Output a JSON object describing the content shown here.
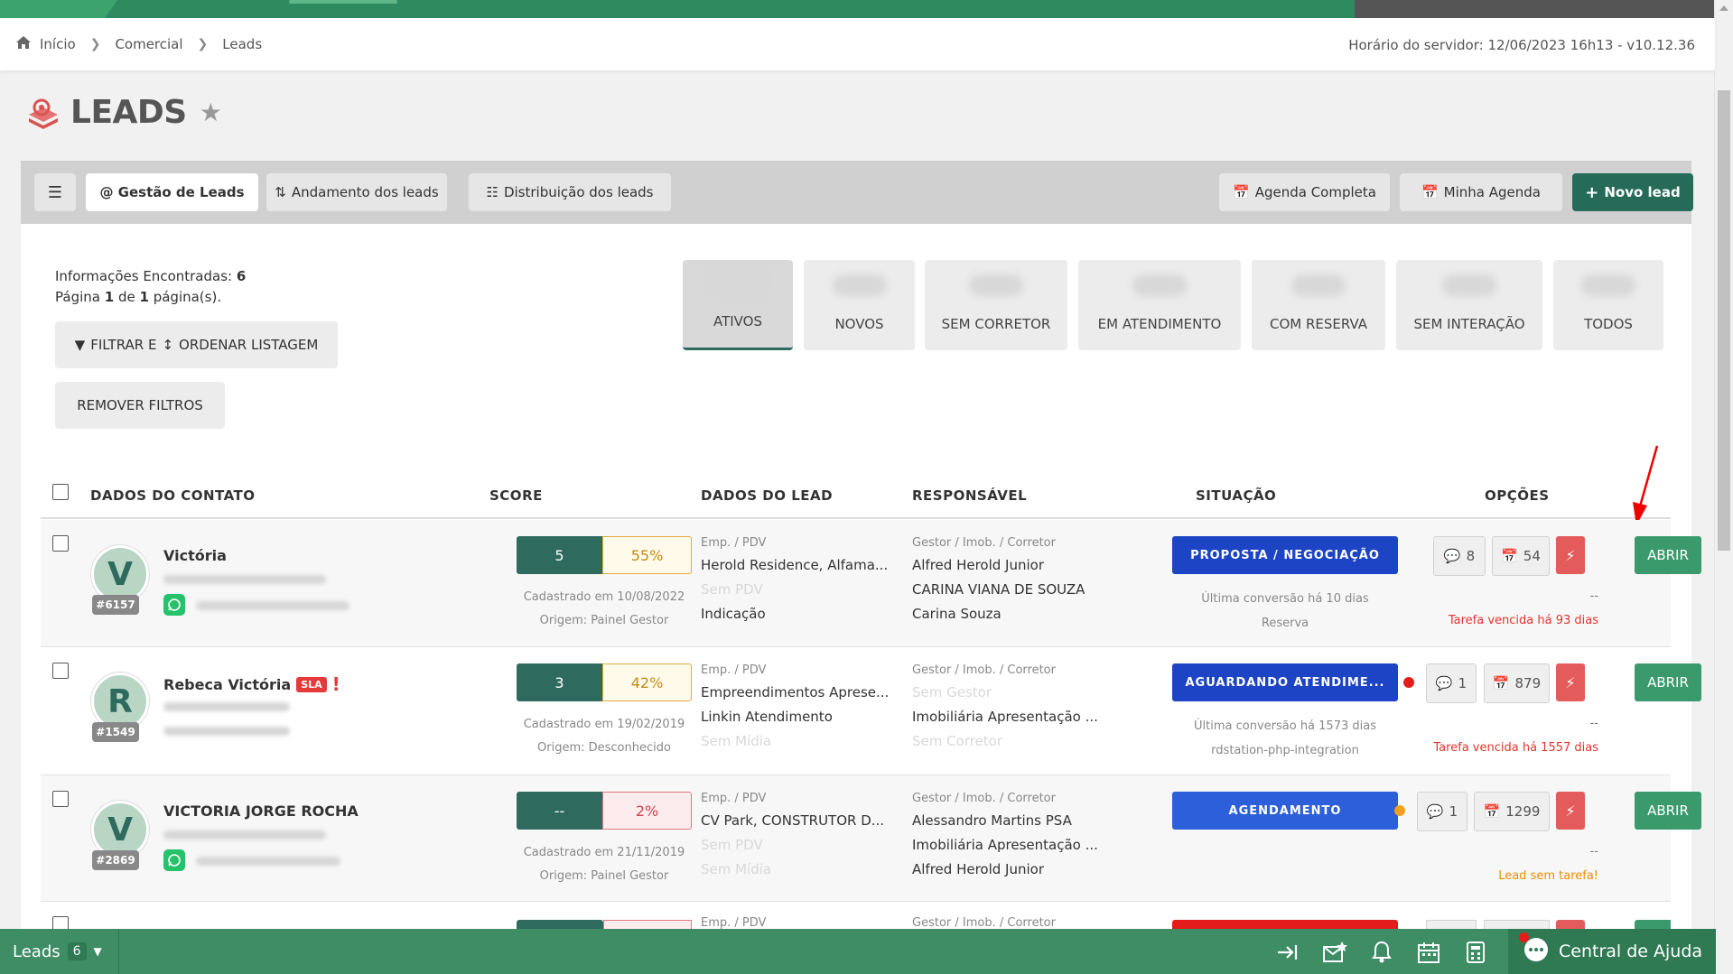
{
  "breadcrumb": {
    "home": "Início",
    "level1": "Comercial",
    "level2": "Leads"
  },
  "server_time": "Horário do servidor: 12/06/2023 16h13 - v10.12.36",
  "page_title": "LEADS",
  "toolbar": {
    "gestao": "@ Gestão de Leads",
    "andamento": "Andamento dos leads",
    "distribuicao": "Distribuição dos leads",
    "agenda_completa": "Agenda Completa",
    "minha_agenda": "Minha Agenda",
    "novo_lead": "Novo lead"
  },
  "info": {
    "found_label": "Informações Encontradas:",
    "found_count": "6",
    "page_a": "Página",
    "page_num": "1",
    "page_b": "de",
    "page_total": "1",
    "page_c": "página(s)."
  },
  "filters": {
    "filter_btn": "FILTRAR E",
    "order_btn": "ORDENAR LISTAGEM",
    "remove_btn": "REMOVER FILTROS"
  },
  "tabs": [
    "ATIVOS",
    "NOVOS",
    "SEM CORRETOR",
    "EM ATENDIMENTO",
    "COM RESERVA",
    "SEM INTERAÇÃO",
    "TODOS"
  ],
  "table": {
    "headers": {
      "contato": "DADOS DO CONTATO",
      "score": "SCORE",
      "lead": "DADOS DO LEAD",
      "responsavel": "RESPONSÁVEL",
      "situacao": "SITUAÇÃO",
      "opcoes": "OPÇÕES"
    },
    "rows": [
      {
        "initial": "V",
        "id": "#6157",
        "name": "Victória",
        "score": "5",
        "pct": "55%",
        "cadastrado": "Cadastrado em 10/08/2022",
        "origem": "Origem: Painel Gestor",
        "emp_label": "Emp. / PDV",
        "emp": "Herold Residence, Alfama...",
        "pdv": "Sem PDV",
        "midia": "Indicação",
        "resp_label": "Gestor / Imob. / Corretor",
        "gestor": "Alfred Herold Junior",
        "imob": "CARINA VIANA DE SOUZA",
        "corretor": "Carina Souza",
        "situacao": "PROPOSTA / NEGOCIAÇÃO",
        "conversao": "Última conversão há 10 dias",
        "etapa": "Reserva",
        "msgs": "8",
        "agenda": "54",
        "dash": "--",
        "task": "Tarefa vencida há 93 dias",
        "abrir": "ABRIR"
      },
      {
        "initial": "R",
        "id": "#1549",
        "name": "Rebeca Victória",
        "sla": "SLA",
        "alert": "!",
        "score": "3",
        "pct": "42%",
        "cadastrado": "Cadastrado em 19/02/2019",
        "origem": "Origem: Desconhecido",
        "emp_label": "Emp. / PDV",
        "emp": "Empreendimentos Aprese...",
        "pdv": "Linkin Atendimento",
        "midia": "Sem Mídia",
        "resp_label": "Gestor / Imob. / Corretor",
        "gestor": "Sem Gestor",
        "imob": "Imobiliária Apresentação ...",
        "corretor": "Sem Corretor",
        "situacao": "AGUARDANDO ATENDIME...",
        "conversao": "Última conversão há 1573 dias",
        "etapa": "rdstation-php-integration",
        "msgs": "1",
        "agenda": "879",
        "dash": "--",
        "task": "Tarefa vencida há 1557 dias",
        "abrir": "ABRIR"
      },
      {
        "initial": "V",
        "id": "#2869",
        "name": "VICTORIA JORGE ROCHA",
        "score": "--",
        "pct": "2%",
        "cadastrado": "Cadastrado em 21/11/2019",
        "origem": "Origem: Painel Gestor",
        "emp_label": "Emp. / PDV",
        "emp": "CV Park, CONSTRUTOR D...",
        "pdv": "Sem PDV",
        "midia": "Sem Mídia",
        "resp_label": "Gestor / Imob. / Corretor",
        "gestor": "Alessandro Martins PSA",
        "imob": "Imobiliária Apresentação ...",
        "corretor": "Alfred Herold Junior",
        "situacao": "AGENDAMENTO",
        "msgs": "1",
        "agenda": "1299",
        "dash": "--",
        "task": "Lead sem tarefa!",
        "abrir": "ABRIR"
      },
      {
        "emp_label": "Emp. / PDV",
        "resp_label": "Gestor / Imob. / Corretor"
      }
    ]
  },
  "bottom": {
    "leads_label": "Leads",
    "leads_count": "6",
    "help": "Central de Ajuda"
  },
  "colors": {
    "primary": "#2e6b5e",
    "green": "#3a9a6c",
    "blue": "#1d44c4",
    "red": "#e3342f",
    "bar": "#3e8d64"
  }
}
